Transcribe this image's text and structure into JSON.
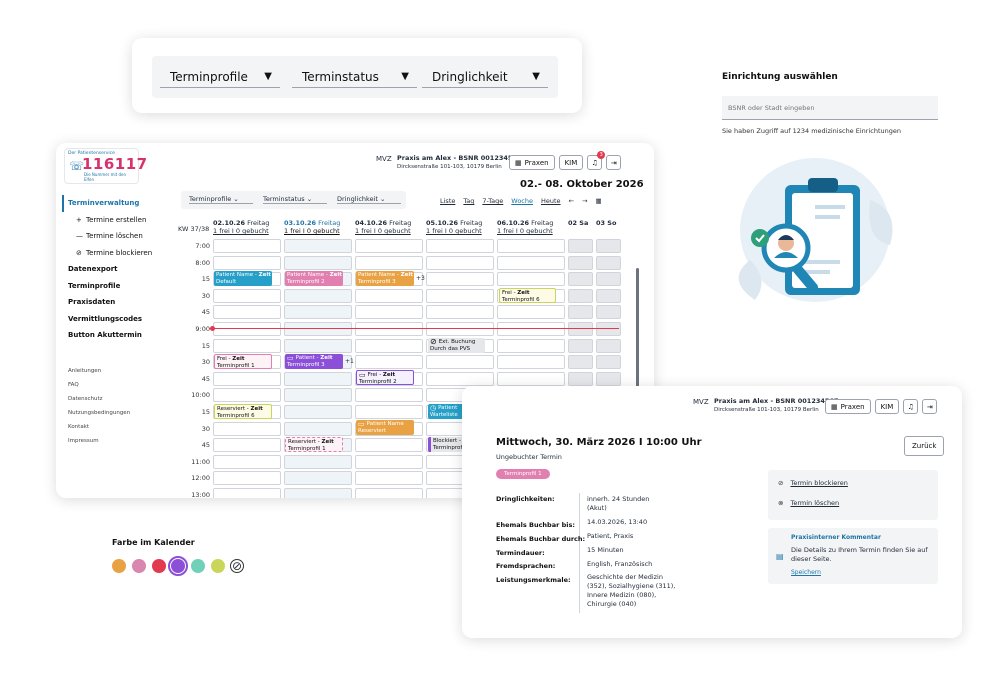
{
  "filters": [
    "Terminprofile",
    "Terminstatus",
    "Dringlichkeit"
  ],
  "calendar": {
    "logo": {
      "top": "Der Patientenservice",
      "number": "116117",
      "sub": "Die Nummer mit den Elfen"
    },
    "practice": {
      "type": "MVZ",
      "name": "Praxis am Alex - BSNR 001234567",
      "address": "Dircksenstraße 101-103, 10179 Berlin"
    },
    "buttons": {
      "praxen": "Praxen",
      "kim": "KIM",
      "badge": "3"
    },
    "date_range": "02.- 08. Oktober 2026",
    "nav": {
      "section": "Terminverwaltung",
      "sub": [
        "Termine erstellen",
        "Termine löschen",
        "Termine blockieren"
      ],
      "main": [
        "Datenexport",
        "Terminprofile",
        "Praxisdaten",
        "Vermittlungscodes",
        "Button Akuttermin"
      ],
      "small": [
        "Anleitungen",
        "FAQ",
        "Datenschutz",
        "Nutzungsbedingungen",
        "Kontakt",
        "Impressum"
      ]
    },
    "filters": [
      "Terminprofile",
      "Terminstatus",
      "Dringlichkeit"
    ],
    "views": [
      "Liste",
      "Tag",
      "7-Tage",
      "Woche",
      "Heute"
    ],
    "week": "KW 37/38",
    "days": [
      {
        "d": "02.10.26",
        "w": "Freitag",
        "s": "1 frei I 0 gebucht"
      },
      {
        "d": "03.10.26",
        "w": "Freitag",
        "s": "1 frei I 0 gebucht"
      },
      {
        "d": "04.10.26",
        "w": "Freitag",
        "s": "1 frei I 0 gebucht"
      },
      {
        "d": "05.10.26",
        "w": "Freitag",
        "s": "1 frei I 0 gebucht"
      },
      {
        "d": "06.10.26",
        "w": "Freitag",
        "s": "1 frei I 0 gebucht"
      }
    ],
    "weekend": [
      "02 Sa",
      "03 So"
    ],
    "times": [
      "7:00",
      "8:00",
      "15",
      "30",
      "45",
      "9:00",
      "15",
      "30",
      "45",
      "10:00",
      "15",
      "30",
      "45",
      "11:00",
      "12:00",
      "13:00"
    ],
    "events": {
      "e1": {
        "t": "Patient Name - ",
        "b": "Zeit",
        "s": "Default"
      },
      "e2": {
        "t": "Patient Name - ",
        "b": "Zeit",
        "s": "Terminprofil 2"
      },
      "e3": {
        "t": "Patient Name - ",
        "b": "Zeit",
        "s": "Terminprofil 3"
      },
      "more1": "+3",
      "e4": {
        "t": "Frei - ",
        "b": "Zeit",
        "s": "Terminprofil 6"
      },
      "e5": {
        "t": "Ext. Buchung",
        "s": "Durch das PVS"
      },
      "e6": {
        "t": "Frei - ",
        "b": "Zeit",
        "s": "Terminprofil 1"
      },
      "e7": {
        "t": "Patient - ",
        "b": "Zeit",
        "s": "Terminprofil 3"
      },
      "more2": "+1",
      "e8": {
        "t": "Frei - ",
        "b": "Zeit",
        "s": "Terminprofil 2"
      },
      "e9": {
        "t": "Reserviert - ",
        "b": "Zeit",
        "s": "Terminprofil 6"
      },
      "e10": {
        "t": "Patient",
        "s": "Warteliste"
      },
      "e11": {
        "t": "Patient Name",
        "s": "Reserviert"
      },
      "e12": {
        "t": "Reserviert - ",
        "b": "Zeit",
        "s": "Terminprofil 1"
      },
      "e13": {
        "t": "Blockiert - Z",
        "s": "Terminprofil"
      }
    }
  },
  "detail": {
    "practice": {
      "type": "MVZ",
      "name": "Praxis am Alex - BSNR 001234567",
      "address": "Dircksenstraße 101-103, 10179 Berlin"
    },
    "buttons": {
      "praxen": "Praxen",
      "kim": "KIM",
      "back": "Zurück"
    },
    "title": "Mittwoch, 30. März 2026 I 10:00 Uhr",
    "subtitle": "Ungebuchter Termin",
    "tag": "Terminprofil 1",
    "fields": [
      {
        "k": "Dringlichkeiten:",
        "v": "innerh. 24 Stunden (Akut)"
      },
      {
        "k": "Ehemals Buchbar bis:",
        "v": "14.03.2026, 13:40"
      },
      {
        "k": "Ehemals Buchbar durch:",
        "v": "Patient, Praxis"
      },
      {
        "k": "Termindauer:",
        "v": "15 Minuten"
      },
      {
        "k": "Fremdsprachen:",
        "v": "English, Französisch"
      },
      {
        "k": "Leistungsmerkmale:",
        "v": "Geschichte der Medizin (352), Sozialhygiene (311), Innere Medizin (080), Chirurgie (040)"
      }
    ],
    "actions": [
      "Termin blockieren",
      "Termin löschen"
    ],
    "comment": {
      "title": "Praxisinterner Kommentar",
      "text": "Die Details zu Ihrem Termin finden Sie auf dieser Seite.",
      "link": "Speichern"
    }
  },
  "einrichtung": {
    "title": "Einrichtung auswählen",
    "placeholder": "BSNR oder Stadt eingeben",
    "info": "Sie haben Zugriff auf 1234 medizinische Einrichtungen"
  },
  "colors": {
    "label": "Farbe im Kalender",
    "swatches": [
      "#e9a243",
      "#d986b0",
      "#e23a4f",
      "#8b4fd8",
      "#6fd1b8",
      "#c9d65a"
    ]
  }
}
